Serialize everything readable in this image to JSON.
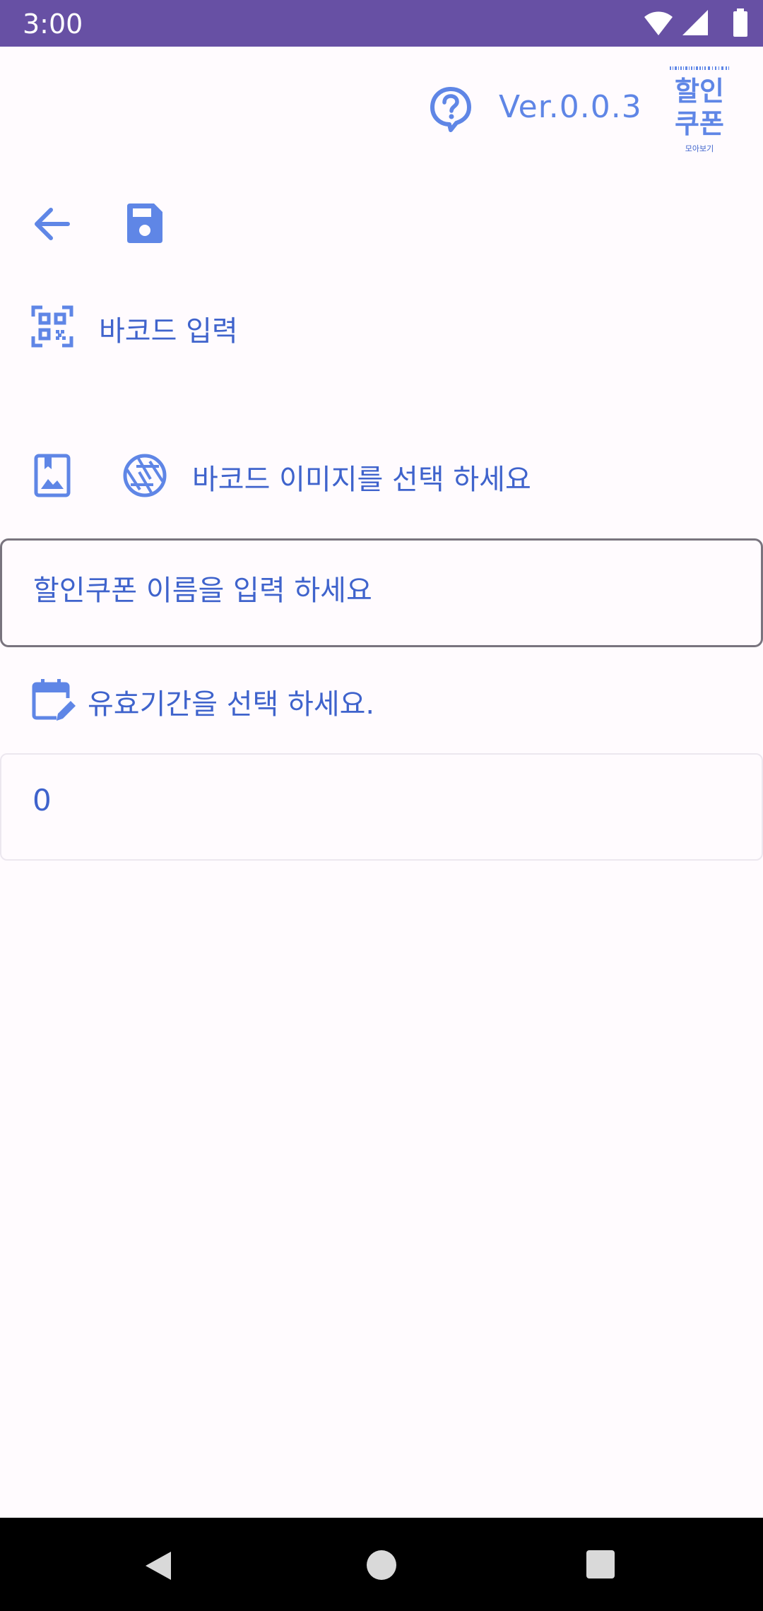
{
  "status_bar": {
    "time": "3:00",
    "icons": [
      "wifi-icon",
      "signal-icon",
      "battery-icon"
    ],
    "color": "#6750a4"
  },
  "header": {
    "help_icon": "help-icon",
    "version": "Ver.0.0.3",
    "logo": {
      "line1": "할인",
      "line2": "쿠폰",
      "caption": "모아보기"
    }
  },
  "toolbar": {
    "back_icon": "arrow-back-icon",
    "save_icon": "save-icon"
  },
  "barcode": {
    "icon": "qr-code-scanner-icon",
    "label": "바코드 입력"
  },
  "image_select": {
    "gallery_icon": "photo-library-icon",
    "camera_icon": "camera-shutter-icon",
    "label": "바코드 이미지를 선택 하세요"
  },
  "coupon_name": {
    "placeholder": "할인쿠폰 이름을 입력 하세요"
  },
  "expiry": {
    "icon": "calendar-edit-icon",
    "label": "유효기간을 선택 하세요."
  },
  "amount": {
    "value": "0"
  },
  "colors": {
    "accent": "#5f86e6",
    "text_blue": "#3f63cc",
    "background": "#fffbfe"
  }
}
